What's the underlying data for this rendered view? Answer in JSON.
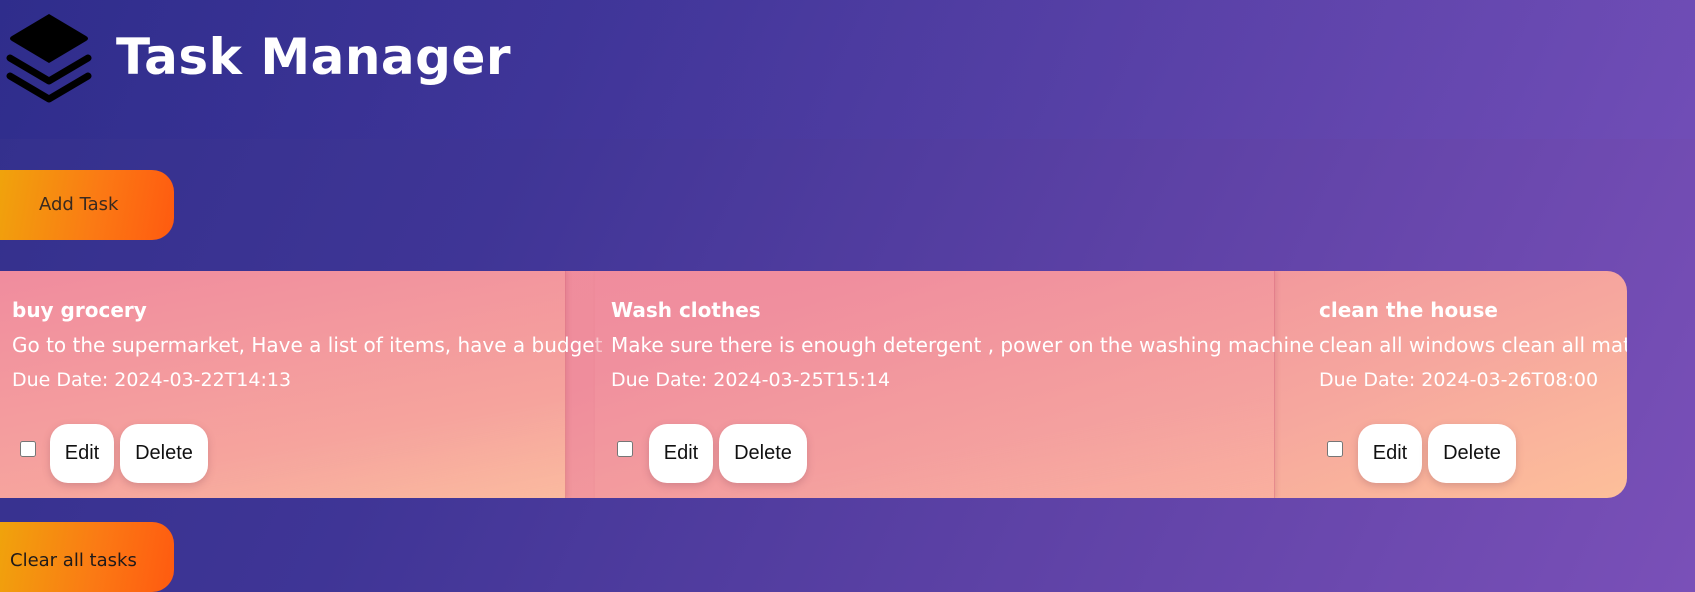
{
  "header": {
    "title": "Task Manager",
    "logo_icon": "layers-stack-icon"
  },
  "actions": {
    "add_label": "Add Task",
    "clear_label": "Clear all tasks"
  },
  "tasks": [
    {
      "name": "buy grocery",
      "description": "Go to the supermarket, Have a list of items, have a budget",
      "due": "Due Date: 2024-03-22T14:13",
      "completed": false,
      "edit_label": "Edit",
      "delete_label": "Delete"
    },
    {
      "name": "Wash clothes",
      "description": "Make sure there is enough detergent , power on the washing machine",
      "due": "Due Date: 2024-03-25T15:14",
      "completed": false,
      "edit_label": "Edit",
      "delete_label": "Delete"
    },
    {
      "name": "clean the house",
      "description": "clean all windows clean all mats",
      "due": "Due Date: 2024-03-26T08:00",
      "completed": false,
      "edit_label": "Edit",
      "delete_label": "Delete"
    }
  ],
  "colors": {
    "background_start": "#33308c",
    "background_end": "#7a50b8",
    "button_orange_start": "#f0a30c",
    "button_orange_end": "#ff5a10",
    "card_pink": "#f08c9e",
    "card_peach": "#fdbf9a"
  }
}
